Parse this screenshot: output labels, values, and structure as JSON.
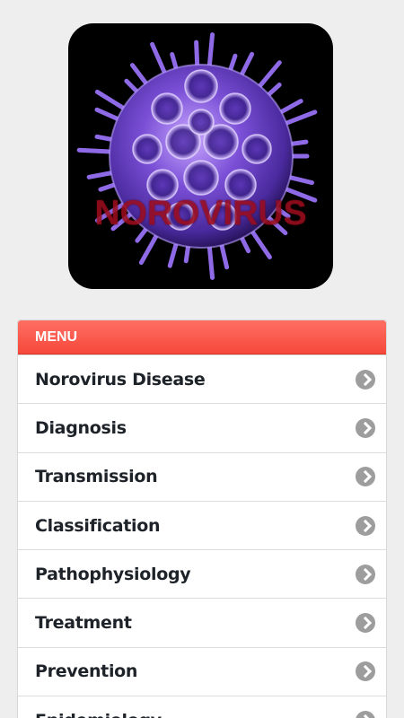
{
  "hero": {
    "title": "NOROVIRUS",
    "image": "norovirus-particle-illustration"
  },
  "menu": {
    "header": "MENU",
    "items": [
      {
        "label": "Norovirus Disease",
        "icon": "chevron-right-icon"
      },
      {
        "label": "Diagnosis",
        "icon": "chevron-right-icon"
      },
      {
        "label": "Transmission",
        "icon": "chevron-right-icon"
      },
      {
        "label": "Classification",
        "icon": "chevron-right-icon"
      },
      {
        "label": "Pathophysiology",
        "icon": "chevron-right-icon"
      },
      {
        "label": "Treatment",
        "icon": "chevron-right-icon"
      },
      {
        "label": "Prevention",
        "icon": "chevron-right-icon"
      },
      {
        "label": "Epidemiology",
        "icon": "chevron-right-icon"
      }
    ]
  },
  "colors": {
    "background": "#eeeeee",
    "menu_header": "#f5483a",
    "title_red": "#9b0d1e",
    "virus_purple": "#6a3ec9",
    "chevron_gray": "#9d9d9d"
  }
}
